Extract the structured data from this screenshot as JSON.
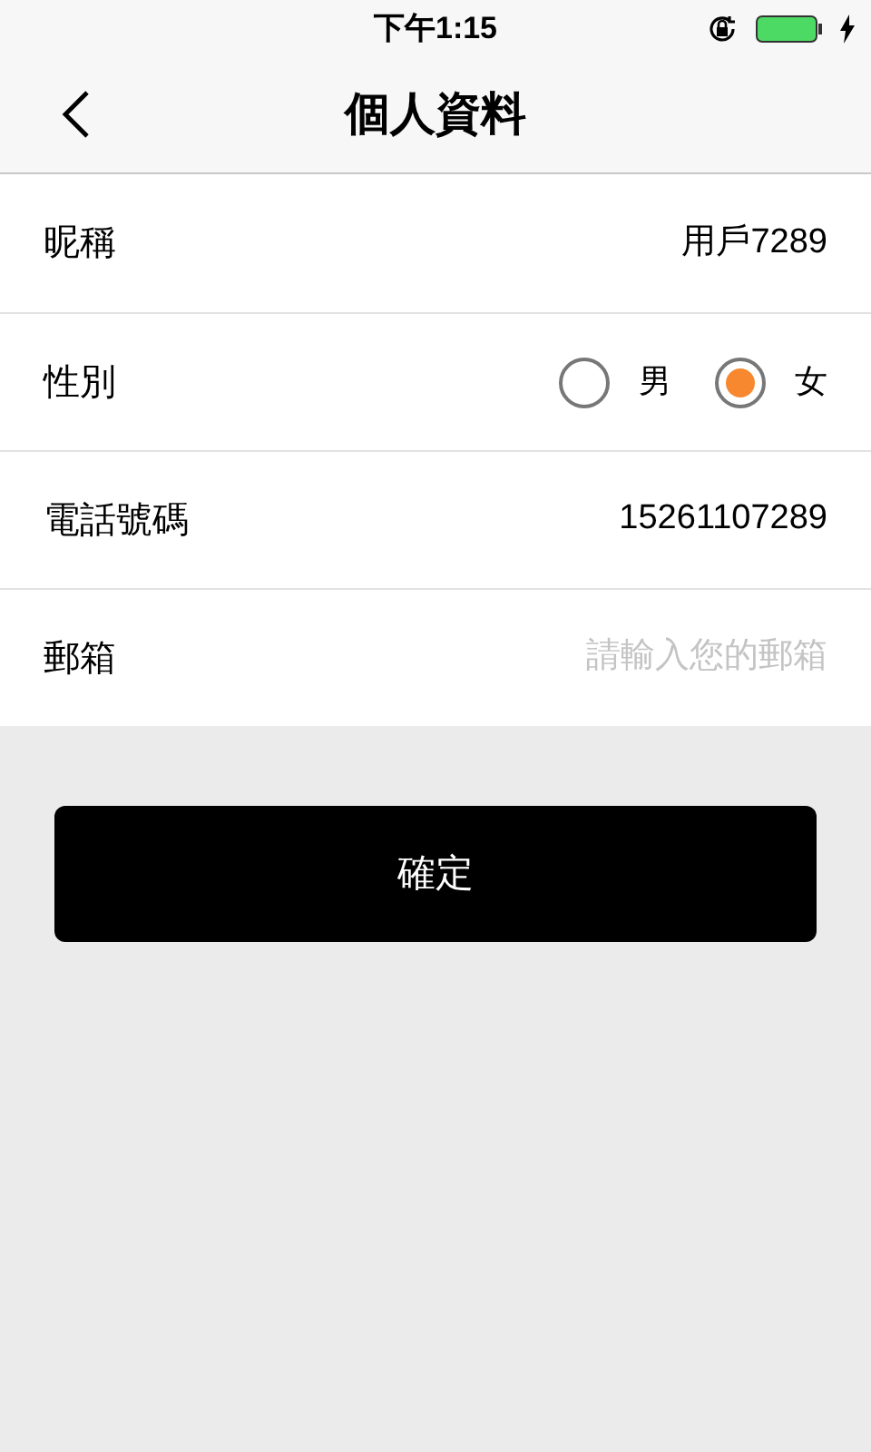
{
  "status_bar": {
    "time": "下午1:15"
  },
  "nav": {
    "title": "個人資料"
  },
  "fields": [
    {
      "kind": "text",
      "label": "昵稱",
      "value": "用戶7289"
    },
    {
      "kind": "radio",
      "label": "性別",
      "options": [
        {
          "label": "男",
          "selected": false
        },
        {
          "label": "女",
          "selected": true
        }
      ]
    },
    {
      "kind": "text",
      "label": "電話號碼",
      "value": "15261107289"
    },
    {
      "kind": "input",
      "label": "郵箱",
      "placeholder": "請輸入您的郵箱"
    }
  ],
  "confirm_button": "確定"
}
